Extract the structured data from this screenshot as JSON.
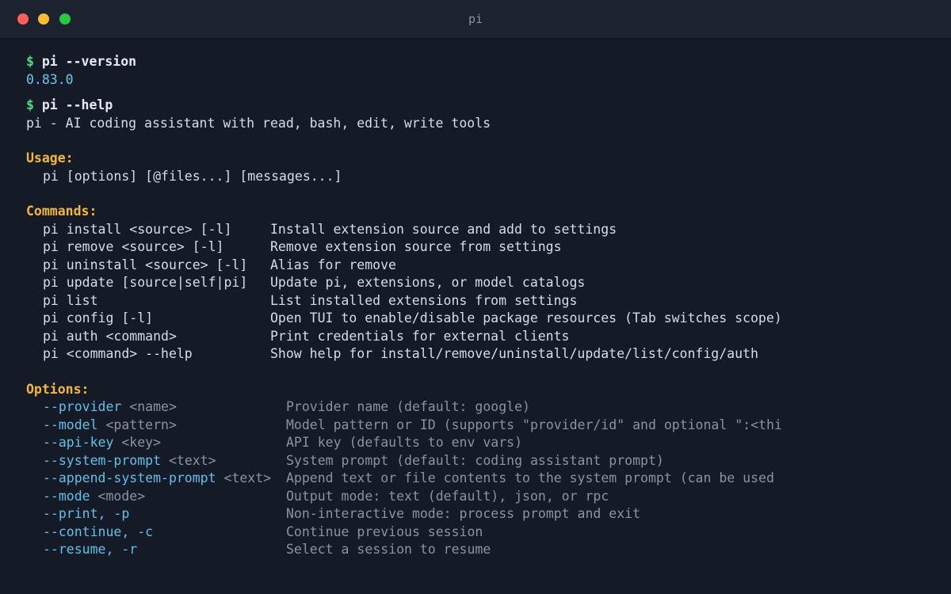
{
  "window": {
    "title": "pi"
  },
  "session": {
    "prompt_symbol": "$",
    "command1": "pi --version",
    "version_output": "0.83.0",
    "command2": "pi --help",
    "help_description": "pi - AI coding assistant with read, bash, edit, write tools"
  },
  "usage": {
    "heading": "Usage:",
    "line": "pi [options] [@files...] [messages...]"
  },
  "commands": {
    "heading": "Commands:",
    "items": [
      {
        "name": "pi install <source> [-l]",
        "description": "Install extension source and add to settings"
      },
      {
        "name": "pi remove <source> [-l]",
        "description": "Remove extension source from settings"
      },
      {
        "name": "pi uninstall <source> [-l]",
        "description": "Alias for remove"
      },
      {
        "name": "pi update [source|self|pi]",
        "description": "Update pi, extensions, or model catalogs"
      },
      {
        "name": "pi list",
        "description": "List installed extensions from settings"
      },
      {
        "name": "pi config [-l]",
        "description": "Open TUI to enable/disable package resources (Tab switches scope)"
      },
      {
        "name": "pi auth <command>",
        "description": "Print credentials for external clients"
      },
      {
        "name": "pi <command> --help",
        "description": "Show help for install/remove/uninstall/update/list/config/auth"
      }
    ]
  },
  "options": {
    "heading": "Options:",
    "items": [
      {
        "flag": "--provider",
        "arg": " <name>",
        "description": "Provider name (default: google)"
      },
      {
        "flag": "--model",
        "arg": " <pattern>",
        "description": "Model pattern or ID (supports \"provider/id\" and optional \":<thi"
      },
      {
        "flag": "--api-key",
        "arg": " <key>",
        "description": "API key (defaults to env vars)"
      },
      {
        "flag": "--system-prompt",
        "arg": " <text>",
        "description": "System prompt (default: coding assistant prompt)"
      },
      {
        "flag": "--append-system-prompt",
        "arg": " <text>",
        "description": "Append text or file contents to the system prompt (can be used"
      },
      {
        "flag": "--mode",
        "arg": " <mode>",
        "description": "Output mode: text (default), json, or rpc"
      },
      {
        "flag": "--print, -p",
        "arg": "",
        "description": "Non-interactive mode: process prompt and exit"
      },
      {
        "flag": "--continue, -c",
        "arg": "",
        "description": "Continue previous session"
      },
      {
        "flag": "--resume, -r",
        "arg": "",
        "description": "Select a session to resume"
      }
    ]
  },
  "colors": {
    "prompt": "#4ade80",
    "version": "#67c7ef",
    "section_heading": "#f5b731",
    "option_flag": "#5fc1ea",
    "muted_text": "#8a93a3",
    "background": "#141b26",
    "titlebar": "#1b2230"
  }
}
